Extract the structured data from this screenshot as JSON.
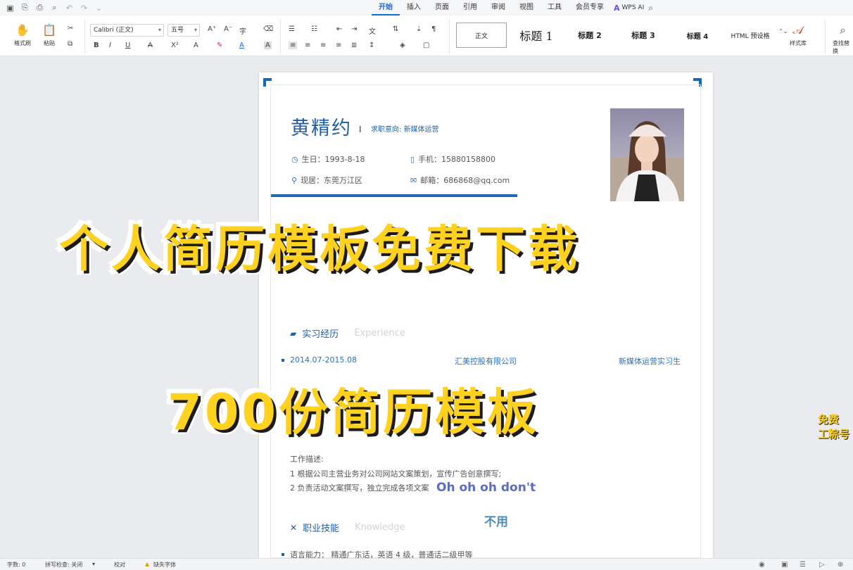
{
  "menu": {
    "tabs": [
      "开始",
      "插入",
      "页面",
      "引用",
      "审阅",
      "视图",
      "工具",
      "会员专享"
    ],
    "active_tab": "开始",
    "wps_ai": "WPS AI"
  },
  "ribbon": {
    "format_painter": "格式刷",
    "paste": "粘贴",
    "font_name": "Calibri (正文)",
    "font_size": "五号",
    "styles": [
      "正文",
      "标题 1",
      "标题 2",
      "标题 3",
      "标题 4",
      "HTML 预设格"
    ],
    "style_gallery": "样式库",
    "find_replace": "查找替换"
  },
  "resume": {
    "name": "黄精约",
    "intent_label": "求职意向:",
    "intent_value": "新媒体运营",
    "birth": "生日：1993-8-18",
    "phone": "手机：15880158800",
    "residence": "现居：东莞万江区",
    "email": "邮箱：686868@qq.com",
    "section_internship": "实习经历",
    "section_internship_en": "Experience",
    "exp_date": "2014.07-2015.08",
    "exp_company": "汇美控股有限公司",
    "exp_role": "新媒体运营实习生",
    "work_desc": "工作描述:",
    "duty1": "1 根据公司主营业务对公司网站文案策划，宣传广告创意撰写;",
    "duty2": "2 负责活动文案撰写，独立完成各项文案",
    "section_skills": "职业技能",
    "section_skills_en": "Knowledge",
    "language": "语言能力：   精通广东话，英语 4 级，普通话二级甲等"
  },
  "overlay": {
    "headline": "个人简历模板免费下载",
    "subline": "700份简历模板",
    "lyric1": "Oh oh oh don't",
    "lyric2": "不用",
    "edge_top": "免费",
    "edge_bottom": "工粽号"
  },
  "status": {
    "word_count": "字数: 0",
    "spellcheck": "拼写检查: 关闭",
    "proofread": "校对",
    "missing_font": "缺失字体"
  },
  "colors": {
    "accent": "#1f5fa6",
    "caption_yellow": "#ffd21f",
    "tab_active": "#1a66d6"
  }
}
